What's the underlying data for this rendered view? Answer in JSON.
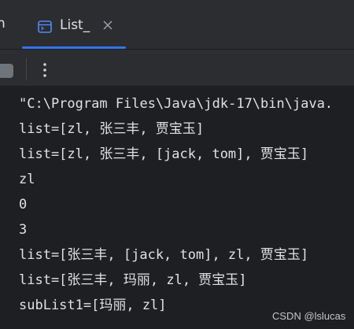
{
  "tabs": {
    "partial_label": "n",
    "active_label": "List_",
    "underline_color": "#3574f0"
  },
  "console": {
    "lines": [
      "\"C:\\Program Files\\Java\\jdk-17\\bin\\java.",
      "list=[zl, 张三丰, 贾宝玉]",
      "list=[zl, 张三丰, [jack, tom], 贾宝玉]",
      "zl",
      "0",
      "3",
      "list=[张三丰, [jack, tom], zl, 贾宝玉]",
      "list=[张三丰, 玛丽, zl, 贾宝玉]",
      "subList1=[玛丽, zl]"
    ]
  },
  "watermark": "CSDN @lslucas",
  "icons": {
    "tab_icon": "console-window-icon",
    "close_icon": "close-icon",
    "stop_icon": "stop-icon",
    "more_icon": "more-vertical-icon"
  }
}
